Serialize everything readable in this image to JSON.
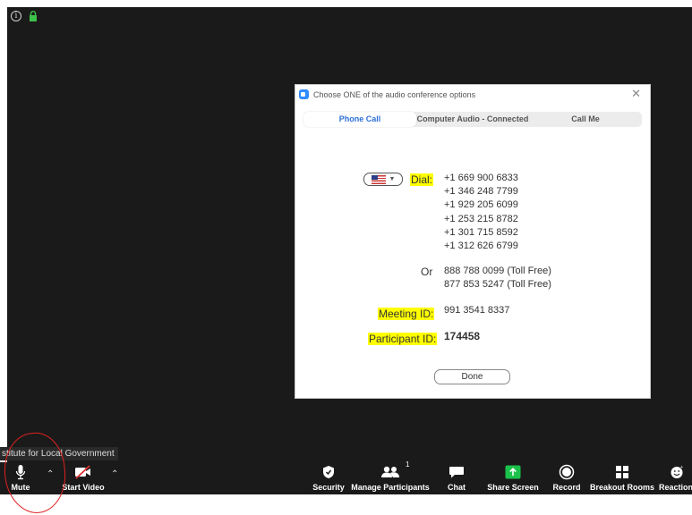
{
  "dialog": {
    "title": "Choose ONE of the audio conference options",
    "close": "✕",
    "tabs": [
      "Phone Call",
      "Computer Audio - Connected",
      "Call Me"
    ],
    "dial_label": "Dial:",
    "dial_numbers": [
      "+1 669 900 6833",
      "+1 346 248 7799",
      "+1 929 205 6099",
      "+1 253 215 8782",
      "+1 301 715 8592",
      "+1 312 626 6799"
    ],
    "or_label": "Or",
    "toll_free": [
      "888 788 0099 (Toll Free)",
      "877 853 5247 (Toll Free)"
    ],
    "meeting_id_label": "Meeting ID:",
    "meeting_id": "991 3541 8337",
    "participant_id_label": "Participant ID:",
    "participant_id": "174458",
    "done": "Done"
  },
  "tooltip": "stitute for Local Government",
  "toolbar": {
    "mute": "Mute",
    "start_video": "Start Video",
    "security": "Security",
    "manage_participants": "Manage Participants",
    "participant_count": "1",
    "chat": "Chat",
    "share_screen": "Share Screen",
    "record": "Record",
    "breakout_rooms": "Breakout Rooms",
    "reactions": "Reactions"
  },
  "colors": {
    "highlight": "#ffff00",
    "accent": "#2d6fd6",
    "share": "#1bc24b",
    "annotation": "#e02020"
  }
}
